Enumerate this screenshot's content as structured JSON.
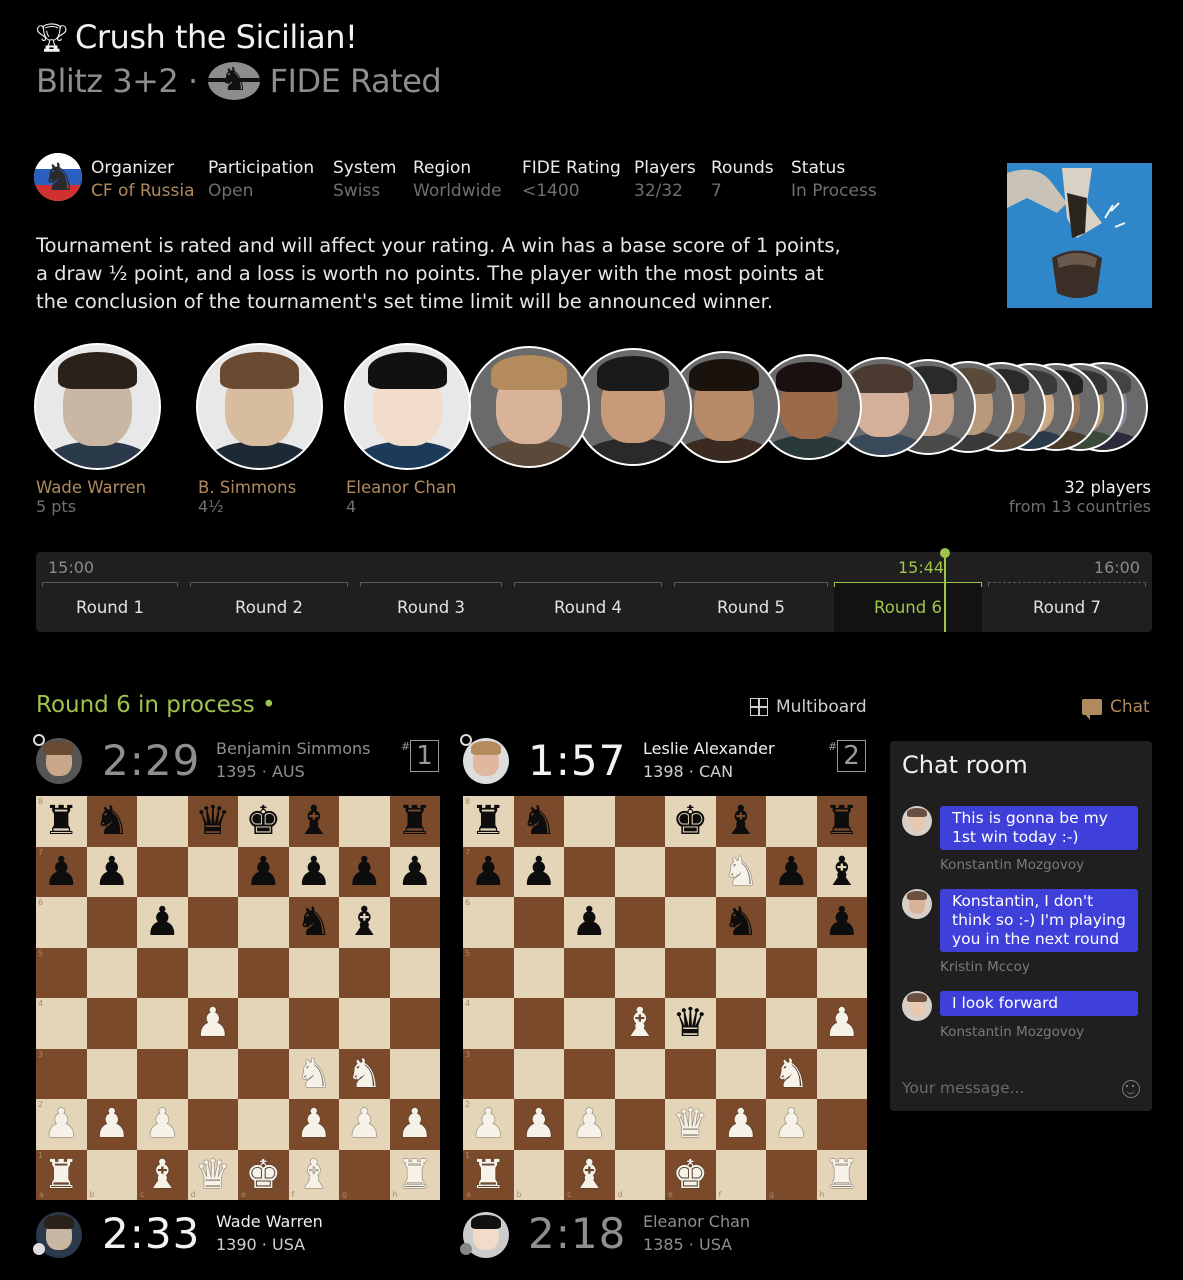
{
  "header": {
    "title": "Crush the Sicilian!",
    "subtitle_format": "Blitz 3+2 ·",
    "subtitle_rated": "FIDE Rated"
  },
  "info": {
    "organizer_label": "Organizer",
    "organizer_value": "CF of Russia",
    "participation_label": "Participation",
    "participation_value": "Open",
    "system_label": "System",
    "system_value": "Swiss",
    "region_label": "Region",
    "region_value": "Worldwide",
    "rating_label": "FIDE Rating",
    "rating_value": "<1400",
    "players_label": "Players",
    "players_value": "32/32",
    "rounds_label": "Rounds",
    "rounds_value": "7",
    "status_label": "Status",
    "status_value": "In Process"
  },
  "description": "Tournament is rated and will affect your rating. A win has a base score of 1 points, a draw ½ point, and a loss is worth no points. The player with the most points at the conclusion of the tournament's set time limit will be announced winner.",
  "leaders": [
    {
      "name": "Wade Warren",
      "points": "5 pts"
    },
    {
      "name": "B. Simmons",
      "points": "4½"
    },
    {
      "name": "Eleanor Chan",
      "points": "4"
    }
  ],
  "players_summary": {
    "count": "32 players",
    "countries": "from 13 countries"
  },
  "timeline": {
    "start": "15:00",
    "now": "15:44",
    "end": "16:00",
    "rounds": [
      "Round 1",
      "Round 2",
      "Round 3",
      "Round 4",
      "Round 5",
      "Round 6",
      "Round 7"
    ],
    "active_round": "Round 6"
  },
  "round_section": {
    "status": "Round 6 in process •",
    "multiboard": "Multiboard",
    "chat": "Chat"
  },
  "games": [
    {
      "board_number": "1",
      "top": {
        "clock": "2:29",
        "name": "Benjamin Simmons",
        "rating": "1395",
        "country": "AUS"
      },
      "bottom": {
        "clock": "2:33",
        "name": "Wade Warren",
        "rating": "1390",
        "country": "USA"
      },
      "position": [
        "r n . q k b . r",
        "p p . . p p p p",
        ". . p . . n b .",
        ". . . . . . . .",
        ". . . P . . . .",
        ". . . . . N N .",
        "P P P . . P P P",
        "R . B Q K B . R"
      ]
    },
    {
      "board_number": "2",
      "top": {
        "clock": "1:57",
        "name": "Leslie Alexander",
        "rating": "1398",
        "country": "CAN"
      },
      "bottom": {
        "clock": "2:18",
        "name": "Eleanor Chan",
        "rating": "1385",
        "country": "USA"
      },
      "position": [
        "r n . . k b . r",
        "p p . . . N p b",
        ". . p . . n . p",
        ". . . . . . . .",
        ". . . B q . . P",
        ". . . . . . N .",
        "P P P . Q P P .",
        "R . B . K . . R"
      ]
    }
  ],
  "chat_room": {
    "title": "Chat room",
    "messages": [
      {
        "text": "This is gonna be my 1st win today :-)",
        "author": "Konstantin Mozgovoy"
      },
      {
        "text": "Konstantin, I don't think so :-) I'm playing you in the next round",
        "author": "Kristin Mccoy"
      },
      {
        "text": "I look forward",
        "author": "Konstantin Mozgovoy"
      }
    ],
    "input_placeholder": "Your message..."
  },
  "colors": {
    "accent_green": "#9fc44a",
    "accent_brown": "#b08a5e",
    "bubble_blue": "#3f3fd9"
  },
  "icons": [
    "trophy-icon",
    "fide-logo",
    "grid-icon",
    "chat-icon",
    "emoji-icon"
  ]
}
